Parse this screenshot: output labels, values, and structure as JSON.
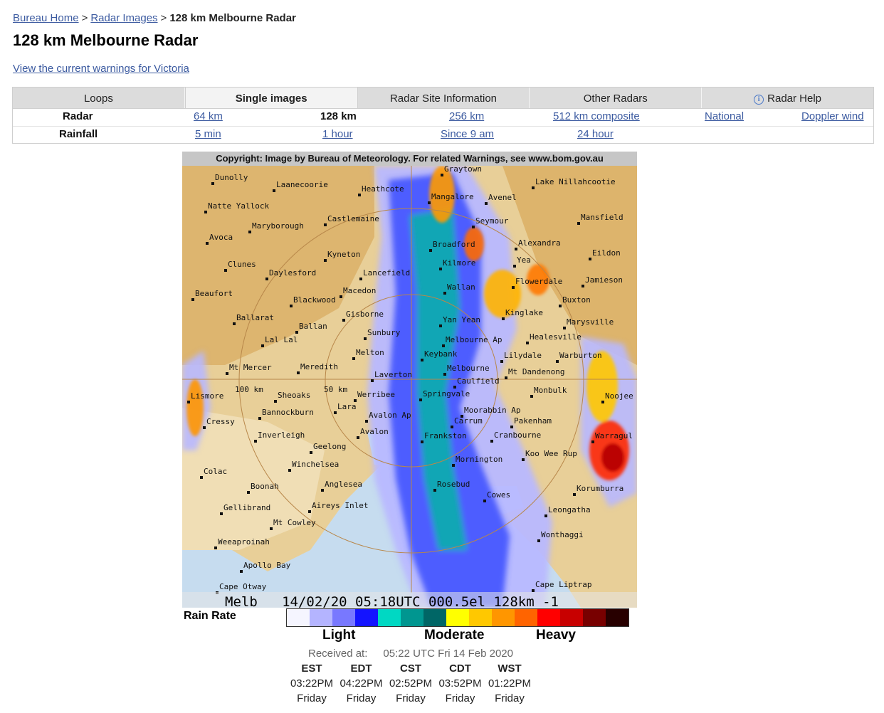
{
  "breadcrumb": {
    "home": "Bureau Home",
    "sep1": ">",
    "radar_images": "Radar Images",
    "sep2": ">",
    "current": "128 km Melbourne Radar"
  },
  "page_title": "128 km Melbourne Radar",
  "warnings_link": "View the current warnings for Victoria",
  "tabs": [
    {
      "label": "Loops",
      "active": false
    },
    {
      "label": "Single images",
      "active": true
    },
    {
      "label": "Radar Site Information",
      "active": false
    },
    {
      "label": "Other Radars",
      "active": false
    },
    {
      "label": "Radar Help",
      "active": false,
      "icon": "info-icon"
    }
  ],
  "radar_row": {
    "heading": "Radar",
    "options": [
      "64 km",
      "128 km",
      "256 km",
      "512 km composite",
      "National",
      "Doppler wind"
    ],
    "current": "128 km"
  },
  "rainfall_row": {
    "heading": "Rainfall",
    "options": [
      "5 min",
      "1 hour",
      "Since 9 am",
      "24 hour"
    ]
  },
  "radar_image": {
    "copyright": "Copyright: Image by Bureau of Meteorology. For related Warnings, see www.bom.gov.au",
    "footer": "Melb   14/02/20 05:18UTC 000.5el 128km -1",
    "range_labels": [
      "100 km",
      "50 km"
    ],
    "places": [
      "Graytown",
      "Dunolly",
      "Laanecoorie",
      "Heathcote",
      "Lake Nillahcootie",
      "Mangalore",
      "Avenel",
      "Natte Yallock",
      "Castlemaine",
      "Seymour",
      "Mansfield",
      "Maryborough",
      "Avoca",
      "Broadford",
      "Alexandra",
      "Kyneton",
      "Eildon",
      "Kilmore",
      "Yea",
      "Clunes",
      "Daylesford",
      "Lancefield",
      "Jamieson",
      "Wallan",
      "Flowerdale",
      "Beaufort",
      "Macedon",
      "Blackwood",
      "Buxton",
      "Gisborne",
      "Kinglake",
      "Marysville",
      "Ballarat",
      "Yan Yean",
      "Ballan",
      "Sunbury",
      "Healesville",
      "Lal Lal",
      "Melbourne Ap",
      "Melton",
      "Lilydale",
      "Warburton",
      "Mt Mercer",
      "Meredith",
      "Keybank",
      "Melbourne",
      "Laverton",
      "Mt Dandenong",
      "Caulfield",
      "Monbulk",
      "Lismore",
      "Sheoaks",
      "Werribee",
      "Springvale",
      "Noojee",
      "Lara",
      "Moorabbin Ap",
      "Bannockburn",
      "Avalon Ap",
      "Pakenham",
      "Cressy",
      "Carrum",
      "Inverleigh",
      "Avalon",
      "Frankston",
      "Cranbourne",
      "Warragul",
      "Geelong",
      "Koo Wee Rup",
      "Winchelsea",
      "Mornington",
      "Colac",
      "Boonah",
      "Anglesea",
      "Rosebud",
      "Korumburra",
      "Cowes",
      "Aireys Inlet",
      "Gellibrand",
      "Leongatha",
      "Mt Cowley",
      "Wonthaggi",
      "Weeaproinah",
      "Apollo Bay",
      "Cape Otway",
      "Cape Liptrap"
    ]
  },
  "legend": {
    "title": "Rain Rate",
    "colors": [
      "#f5f5ff",
      "#b4b4ff",
      "#7878ff",
      "#1414ff",
      "#00d8c3",
      "#009690",
      "#006666",
      "#ffff00",
      "#ffc800",
      "#ff9600",
      "#ff6400",
      "#ff0000",
      "#c80000",
      "#780000",
      "#280000"
    ],
    "labels": [
      "Light",
      "Moderate",
      "Heavy"
    ]
  },
  "received": {
    "label": "Received at:",
    "value": "05:22 UTC Fri 14 Feb 2020"
  },
  "timezones": [
    {
      "zone": "EST",
      "time": "03:22PM",
      "day": "Friday"
    },
    {
      "zone": "EDT",
      "time": "04:22PM",
      "day": "Friday"
    },
    {
      "zone": "CST",
      "time": "02:52PM",
      "day": "Friday"
    },
    {
      "zone": "CDT",
      "time": "03:52PM",
      "day": "Friday"
    },
    {
      "zone": "WST",
      "time": "01:22PM",
      "day": "Friday"
    }
  ]
}
